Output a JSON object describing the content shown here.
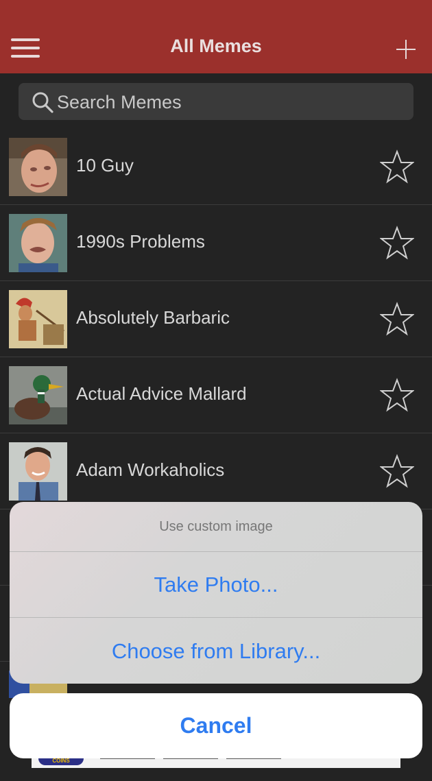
{
  "header": {
    "title": "All Memes"
  },
  "search": {
    "placeholder": "Search Memes"
  },
  "memes": [
    {
      "label": "10 Guy",
      "favorite": false
    },
    {
      "label": "1990s Problems",
      "favorite": false
    },
    {
      "label": "Absolutely Barbaric",
      "favorite": false
    },
    {
      "label": "Actual Advice Mallard",
      "favorite": false
    },
    {
      "label": "Adam Workaholics",
      "favorite": false
    }
  ],
  "action_sheet": {
    "title": "Use custom image",
    "take_photo": "Take Photo...",
    "choose_library": "Choose from Library...",
    "cancel": "Cancel"
  },
  "ad": {
    "logo_text": "COINS"
  },
  "colors": {
    "header": "#9b302c",
    "background": "#232323",
    "action_blue": "#2f7cf0"
  }
}
